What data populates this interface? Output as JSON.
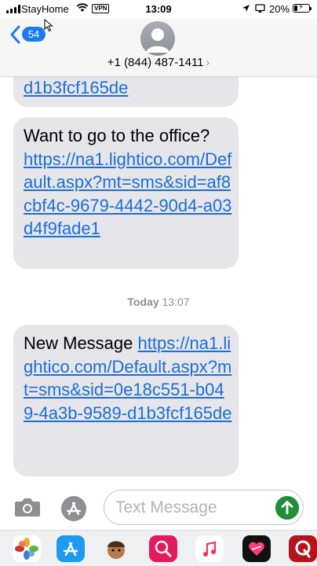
{
  "status_bar": {
    "carrier": "StayHome",
    "vpn": "VPN",
    "time": "13:09",
    "battery_percent": "20%",
    "battery_level": 0.2
  },
  "header": {
    "back_count": "54",
    "contact": "+1 (844) 487-1411",
    "contact_chevron": "›"
  },
  "messages": [
    {
      "text": "",
      "link": "d1b3fcf165de"
    },
    {
      "text": "Want to go to the office?",
      "link": "https://na1.lightico.com/Default.aspx?mt=sms&sid=af8cbf4c-9679-4442-90d4-a03d4f9fade1"
    },
    {
      "text": "New Message ",
      "link": "https://na1.lightico.com/Default.aspx?mt=sms&sid=0e18c551-b049-4a3b-9589-d1b3fcf165de"
    }
  ],
  "timestamp": {
    "day": "Today",
    "time": "13:07"
  },
  "input": {
    "placeholder": "Text Message"
  },
  "colors": {
    "accent": "#1a7cf5",
    "link": "#1c6fd6",
    "bubble": "#e5e5ea",
    "send": "#1e8f36"
  },
  "icons": [
    "back-chevron-icon",
    "camera-icon",
    "app-store-icon",
    "send-arrow-icon",
    "photos-app-icon",
    "app-store-app-icon",
    "memoji-app-icon",
    "search-images-app-icon",
    "music-app-icon",
    "heart-app-icon",
    "q-app-icon"
  ]
}
